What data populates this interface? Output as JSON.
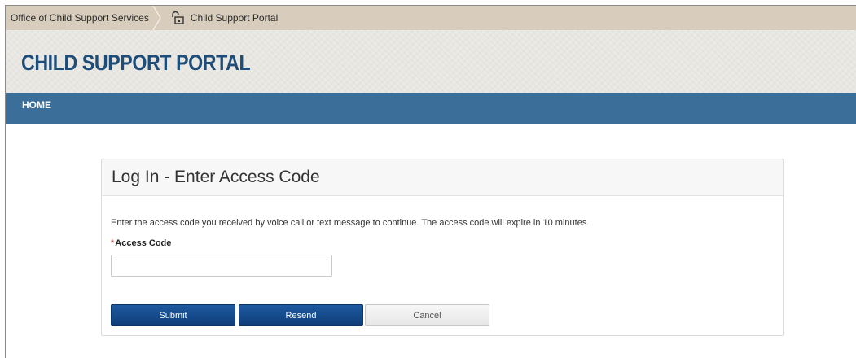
{
  "breadcrumb": {
    "parent": "Office of Child Support Services",
    "current": "Child Support Portal",
    "current_icon": "lock-icon"
  },
  "header": {
    "title": "CHILD SUPPORT PORTAL"
  },
  "nav": {
    "home_label": "HOME"
  },
  "login": {
    "title": "Log In - Enter Access Code",
    "instructions": "Enter the access code you received by voice call or text message to continue. The access code will expire in 10 minutes.",
    "required_marker": "*",
    "access_code_label": "Access Code",
    "access_code_value": "",
    "submit_label": "Submit",
    "resend_label": "Resend",
    "cancel_label": "Cancel"
  },
  "colors": {
    "brand_blue": "#1f4d79",
    "nav_blue": "#3b6e98",
    "button_blue": "#0f3d78",
    "breadcrumb_bg": "#d8cdbc",
    "required_red": "#c0392b"
  }
}
